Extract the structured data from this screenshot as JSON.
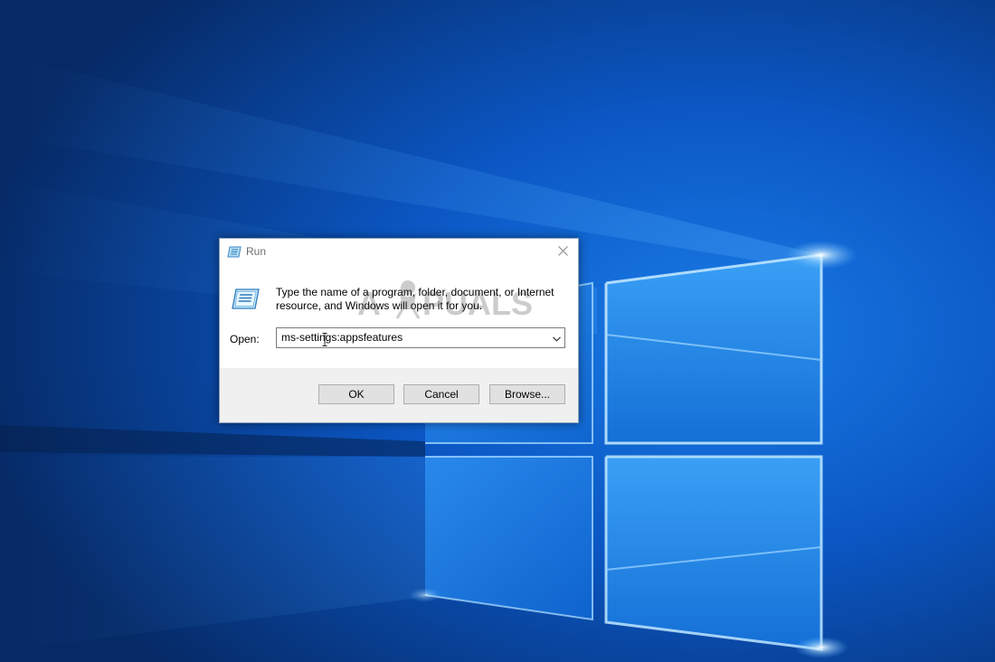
{
  "desktop": {
    "wallpaper": "windows-10-hero",
    "colors": {
      "background_dark": "#062a66",
      "background_mid": "#0b57c4",
      "light": "#7ec9ff"
    }
  },
  "dialog": {
    "title": "Run",
    "description": "Type the name of a program, folder, document, or Internet resource, and Windows will open it for you.",
    "open_label": "Open:",
    "open_value": "ms-settings:appsfeatures",
    "buttons": {
      "ok": "OK",
      "cancel": "Cancel",
      "browse": "Browse..."
    },
    "watermark": "APPUALS",
    "icons": {
      "title": "run-icon",
      "content": "run-icon",
      "close": "close-icon",
      "dropdown": "chevron-down-icon"
    }
  }
}
